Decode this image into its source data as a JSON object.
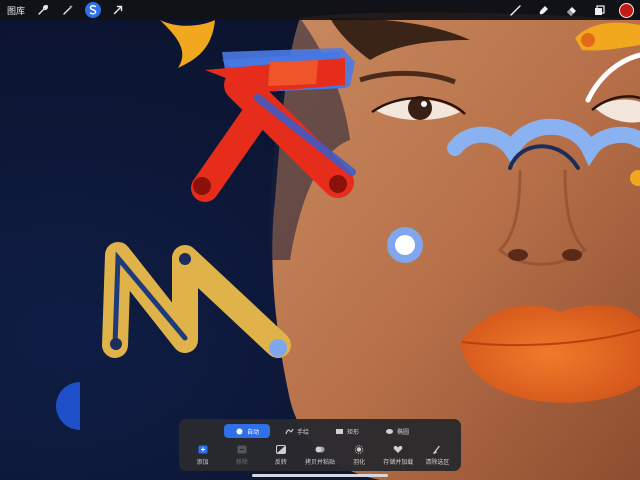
{
  "toolbar": {
    "gallery_label": "图库",
    "left_tools": [
      {
        "icon": "wrench-icon",
        "active": false
      },
      {
        "icon": "magic-wand-icon",
        "active": false
      },
      {
        "icon": "selection-icon",
        "active": true
      },
      {
        "icon": "transform-arrow-icon",
        "active": false
      }
    ],
    "right_tools": [
      "brush-icon",
      "smudge-icon",
      "eraser-icon",
      "layers-icon"
    ],
    "current_color": "#c21d14"
  },
  "selection_panel": {
    "modes": [
      {
        "label": "自动",
        "icon": "dot-icon",
        "active": true
      },
      {
        "label": "手绘",
        "icon": "freehand-icon",
        "active": false
      },
      {
        "label": "矩形",
        "icon": "rectangle-icon",
        "active": false
      },
      {
        "label": "椭圆",
        "icon": "ellipse-icon",
        "active": false
      }
    ],
    "actions": [
      {
        "label": "添加",
        "icon": "add-icon",
        "enabled": true
      },
      {
        "label": "移除",
        "icon": "remove-icon",
        "enabled": false
      },
      {
        "label": "反转",
        "icon": "invert-icon",
        "enabled": true
      },
      {
        "label": "拷贝并粘贴",
        "icon": "copy-paste-icon",
        "enabled": true
      },
      {
        "label": "羽化",
        "icon": "feather-icon",
        "enabled": true
      },
      {
        "label": "存储并加载",
        "icon": "save-load-icon",
        "enabled": true
      },
      {
        "label": "清除选区",
        "icon": "clear-selection-icon",
        "enabled": true
      }
    ]
  },
  "colors": {
    "accent": "#2f6fe8",
    "toolbar_bg": "#121216",
    "panel_bg": "#2a2a2e"
  }
}
